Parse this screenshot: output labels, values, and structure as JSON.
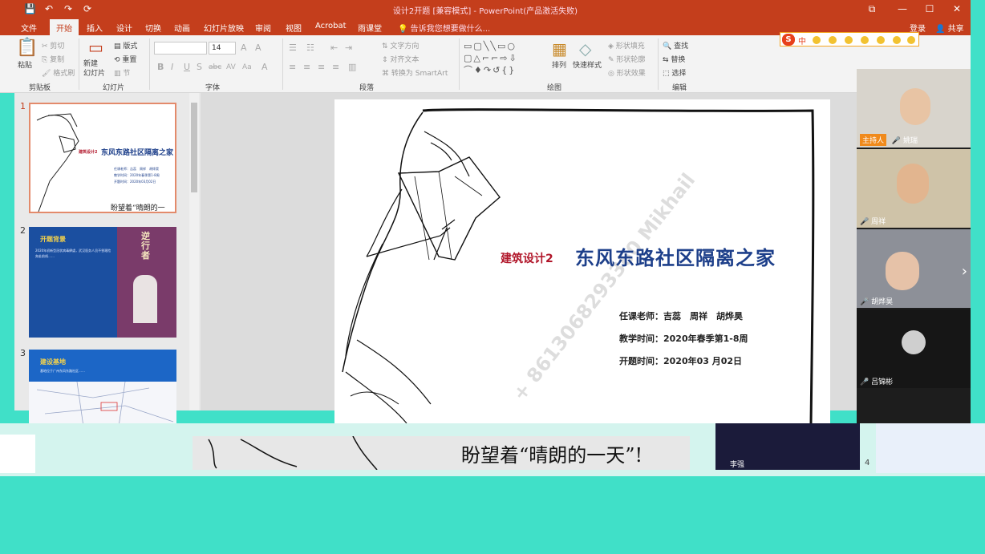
{
  "window": {
    "title": "设计2开题 [兼容模式] - PowerPoint(产品激活失败)",
    "buttons": [
      "⧉",
      "—",
      "☐",
      "✕"
    ]
  },
  "quick_access": [
    "💾",
    "↶",
    "↷",
    "⟳"
  ],
  "ribbon": {
    "tabs": [
      "文件",
      "开始",
      "插入",
      "设计",
      "切换",
      "动画",
      "幻灯片放映",
      "审阅",
      "视图",
      "Acrobat",
      "雨课堂"
    ],
    "active_tab": "开始",
    "tell_me": "告诉我您想要做什么...",
    "login": "登录",
    "share": "共享",
    "clipboard": {
      "paste": "粘贴",
      "cut": "剪切",
      "copy": "复制",
      "format_painter": "格式刷",
      "label": "剪贴板"
    },
    "slides": {
      "new_slide": "新建\n幻灯片",
      "layout": "版式",
      "reset": "重置",
      "section": "节",
      "label": "幻灯片"
    },
    "font": {
      "name_value": "",
      "size_value": "14",
      "bold": "B",
      "italic": "I",
      "underline": "U",
      "shadow": "S",
      "strike": "abc",
      "spacing": "AV",
      "case": "Aa",
      "label": "字体"
    },
    "paragraph": {
      "direction": "文字方向",
      "align": "对齐文本",
      "smartart": "转换为 SmartArt",
      "label": "段落"
    },
    "drawing": {
      "arrange": "排列",
      "quick_styles": "快速样式",
      "fill": "形状填充",
      "outline": "形状轮廓",
      "effects": "形状效果",
      "label": "绘图"
    },
    "editing": {
      "find": "查找",
      "replace": "替换",
      "select": "选择",
      "label": "编辑"
    }
  },
  "ime_bar": {
    "logo": "S",
    "mode": "中"
  },
  "thumbnails": [
    {
      "number": "1",
      "course": "建筑设计2",
      "title": "东风东路社区隔离之家",
      "lines": [
        "任课老师：吉蕊　周祥　胡烨昊",
        "教学时间：2020年春季第1-8周",
        "开题时间：2020年03月02日"
      ],
      "slogan": "盼望着“晴朗的一天”"
    },
    {
      "number": "2",
      "heading": "开题背景",
      "side_text": "逆\n行\n者",
      "body": "2020年初新型冠状病毒肆虐，武汉医务人员不畏艰险奔赴前线……"
    },
    {
      "number": "3",
      "heading": "建设基地",
      "body": "基地位于广州东风东路社区……"
    }
  ],
  "slide": {
    "course": "建筑设计2",
    "title": "东风东路社区隔离之家",
    "teachers": "任课老师：吉蕊　周祥　胡烨昊",
    "teaching_time": "教学时间：2020年春季第1-8周",
    "start_time": "开题时间：2020年03 月02日",
    "watermark": "+ 8613068293360 Mikhail",
    "slogan": "盼望着“晴朗的一天”!"
  },
  "video_panel": {
    "participants": [
      {
        "name": "姚瑞",
        "role": "主持人",
        "bg": "#d8d4cc",
        "face": "#e8c4a4"
      },
      {
        "name": "周祥",
        "role": "",
        "bg": "#cfc3a8",
        "face": "#e2b58f"
      },
      {
        "name": "胡烨昊",
        "role": "",
        "bg": "#8d9098",
        "face": "#e6c2a8"
      },
      {
        "name": "吕锦彬",
        "role": "",
        "bg": "#161616",
        "face": "#cfcfcf"
      }
    ],
    "next_arrow": "›"
  },
  "glitch": {
    "video_name": "李强",
    "slide_number": "4"
  }
}
